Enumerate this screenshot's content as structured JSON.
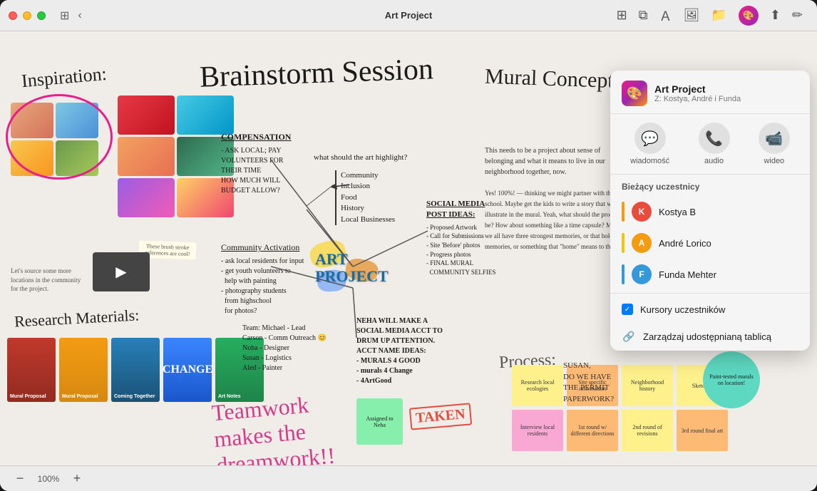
{
  "window": {
    "title": "Art Project",
    "zoom_level": "100%"
  },
  "titlebar": {
    "back_label": "‹",
    "title": "Art Project",
    "tools": [
      "grid-icon",
      "layers-icon",
      "text-icon",
      "image-icon",
      "folder-icon"
    ]
  },
  "collab_panel": {
    "title": "Art Project",
    "subtitle": "Z: Kostya, André i Funda",
    "icon": "🎨",
    "actions": [
      {
        "icon": "💬",
        "label": "wiadomość"
      },
      {
        "icon": "📞",
        "label": "audio"
      },
      {
        "icon": "📹",
        "label": "wideo"
      }
    ],
    "section_title": "Bieżący uczestnicy",
    "participants": [
      {
        "name": "Kostya B",
        "initials": "K",
        "color_class": "avatar-kostya",
        "bar_class": "bar-orange"
      },
      {
        "name": "André Lorico",
        "initials": "A",
        "color_class": "avatar-andre",
        "bar_class": "bar-yellow"
      },
      {
        "name": "Funda Mehter",
        "initials": "F",
        "color_class": "avatar-funda",
        "bar_class": "bar-blue"
      }
    ],
    "options": [
      {
        "label": "Kursory uczestników",
        "checked": true
      },
      {
        "label": "Zarządzaj udostępnianą tablicą",
        "icon": "🔗"
      }
    ]
  },
  "canvas": {
    "inspiration_label": "Inspiration:",
    "research_label": "Research Materials:",
    "brainstorm_title": "Brainstorm Session",
    "mural_title": "Mural Concepts",
    "art_project_center": "ART\nPROJECT",
    "teamwork_text": "Teamwork\nmakes the\ndreamwork!!",
    "taken_stamp": "TAKEN",
    "assigned_sticky": "Assigned to\nNeha",
    "change_label": "CHANGE",
    "process_label": "Process:",
    "let_source_text": "Let's source some more locations in the community for the project.",
    "brush_note": "These brush stroke references are cool!",
    "susan_text": "SUSAN,\nDO WE HAVE\nTHE PERMIT\nPAPERWORK?",
    "compensation_text": "COMPENSATION\n- ASK LOCAL PAY\nVOLUNTEERS FOR\nTHEIR TIME\nHOW MUCH WILL\nBUDGET ALLOW?",
    "community_activation": "Community Activation\n- ask local residents for input\n- get youth volunteers to\nhelp with painting\n- photography students\nfrom highschool\nfor photos?",
    "what_highlight": "what should the art highlight?",
    "highlights": "Community\nInclusion\nFood\nHistory\nLocal Businesses",
    "social_media": "SOCIAL MEDIA\nPOST IDEAS:\n- Proposed Artwork\n- Call for Submissions\n- Site 'Before' photos\n- Progress photos\n- FINAL MURAL\n  COMMUNITY SELFIES",
    "neha_text": "NEHA WILL MAKE A\nSOCIAL MEDIA ACCT TO\nDRUM UP ATTENTION.\nACCT NAME IDEAS:\n- MURALS 4 GOOD\n- murals 4 Change\n- 4ArtGood",
    "team_text": "Team: Michael - Lead\nCarson - Comm Outreach\nNoha - Designer\nSusan - Logistics\nAled - Painter",
    "mural_notes": "This needs to be a project about sense of belonging and what it means to live in our neighborhood together, now.",
    "sticky_notes": [
      {
        "text": "Research local ecologies",
        "color": "sticky-yellow"
      },
      {
        "text": "Site specific information",
        "color": "sticky-orange"
      },
      {
        "text": "Neighborhood history",
        "color": "sticky-yellow"
      },
      {
        "text": "1st round w/ different directions",
        "color": "sticky-orange"
      },
      {
        "text": "2nd round of revisions",
        "color": "sticky-yellow"
      },
      {
        "text": "3rd round final art",
        "color": "sticky-orange"
      },
      {
        "text": "Interview local residents",
        "color": "sticky-pink"
      },
      {
        "text": "Sketches",
        "color": "sticky-yellow"
      }
    ]
  },
  "statusbar": {
    "minus_label": "−",
    "zoom_label": "100%",
    "plus_label": "+"
  }
}
